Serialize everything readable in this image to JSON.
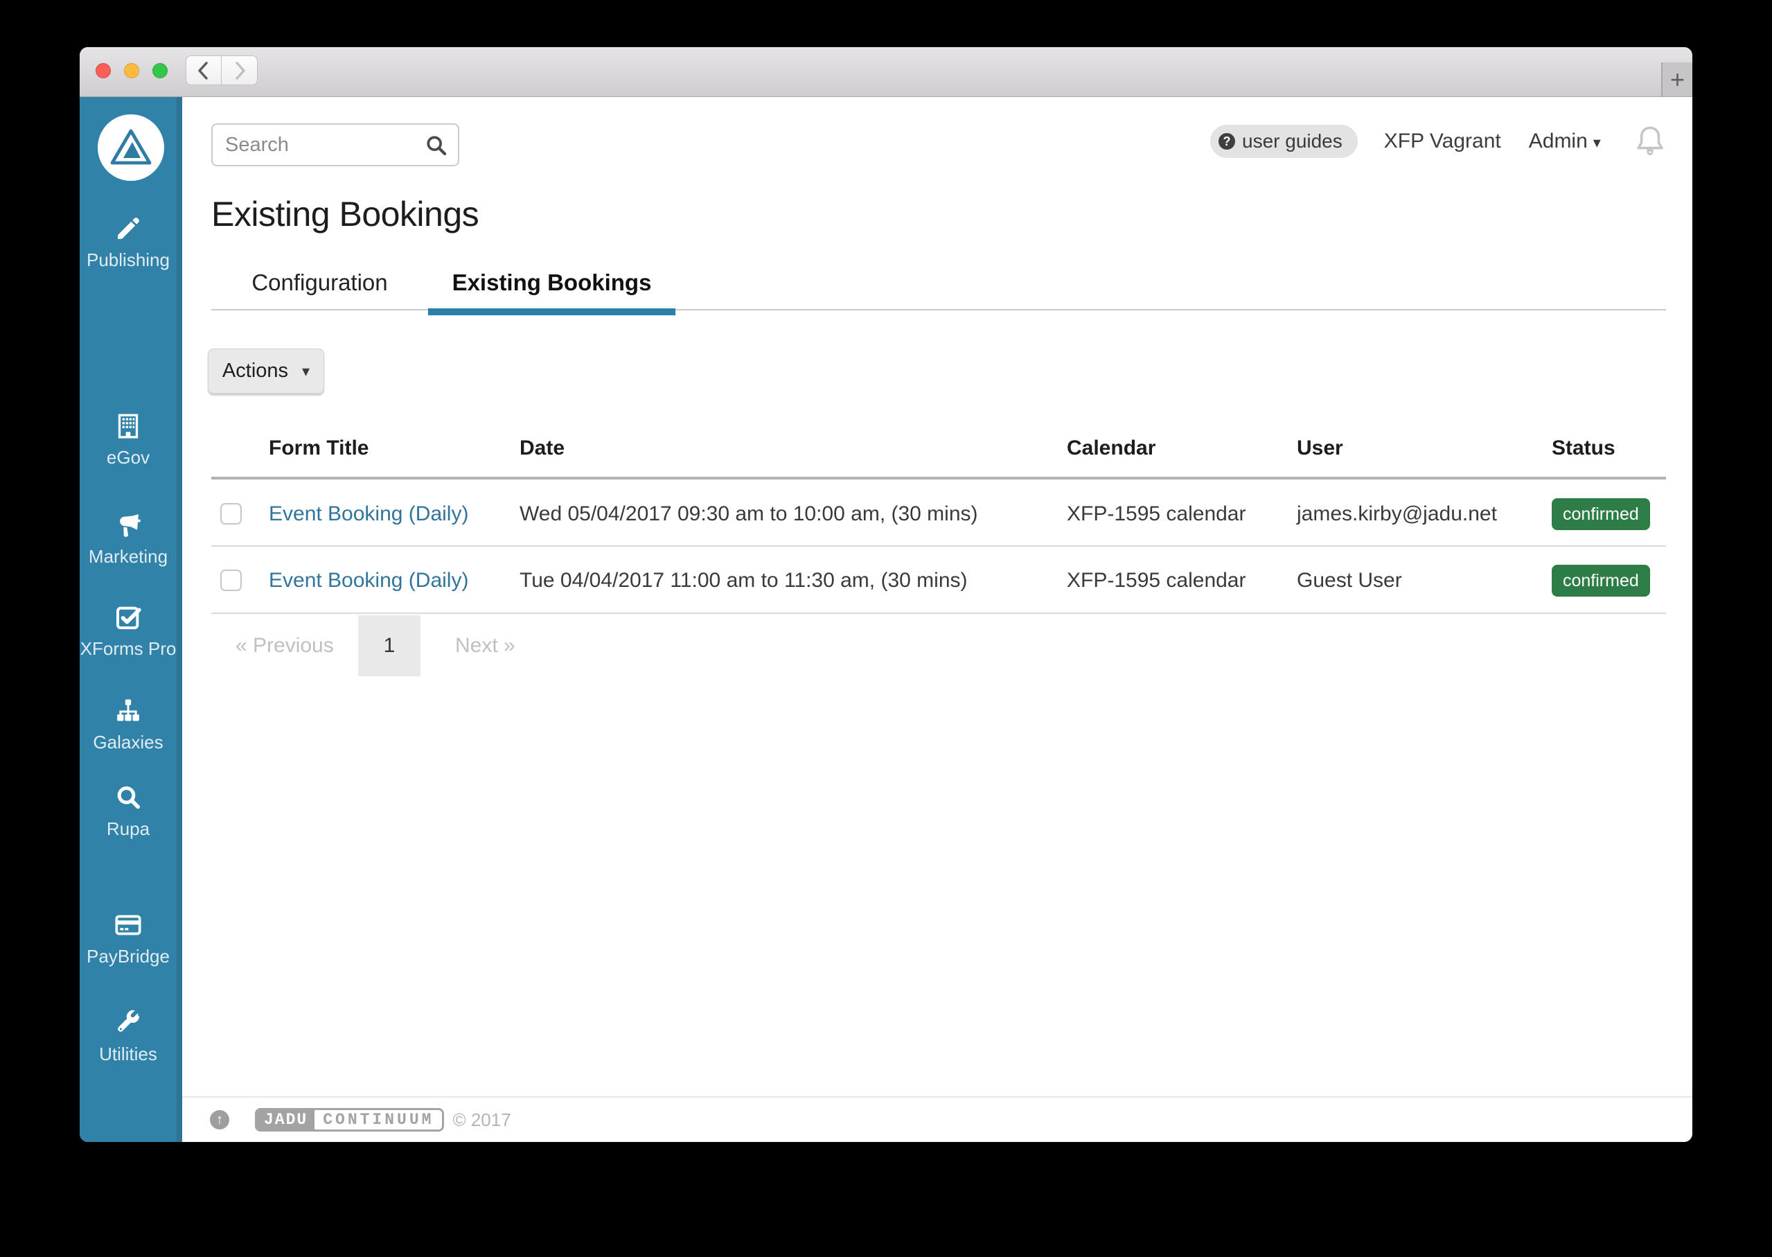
{
  "window": {
    "new_tab_label": "+"
  },
  "sidebar": {
    "items": [
      {
        "label": "Publishing",
        "icon": "pencil-icon"
      },
      {
        "label": "eGov",
        "icon": "building-icon"
      },
      {
        "label": "Marketing",
        "icon": "megaphone-icon"
      },
      {
        "label": "XForms Pro",
        "icon": "checkbox-icon"
      },
      {
        "label": "Galaxies",
        "icon": "sitemap-icon"
      },
      {
        "label": "Rupa",
        "icon": "magnifier-icon"
      },
      {
        "label": "PayBridge",
        "icon": "credit-card-icon"
      },
      {
        "label": "Utilities",
        "icon": "wrench-icon"
      }
    ]
  },
  "header": {
    "search_placeholder": "Search",
    "user_guides_label": "user guides",
    "account_label": "XFP Vagrant",
    "admin_label": "Admin"
  },
  "page": {
    "title": "Existing Bookings"
  },
  "tabs": [
    {
      "label": "Configuration",
      "active": false
    },
    {
      "label": "Existing Bookings",
      "active": true
    }
  ],
  "actions": {
    "label": "Actions"
  },
  "table": {
    "columns": [
      "Form Title",
      "Date",
      "Calendar",
      "User",
      "Status"
    ],
    "rows": [
      {
        "form_title": "Event Booking (Daily)",
        "date": "Wed 05/04/2017 09:30 am to 10:00 am, (30 mins)",
        "calendar": "XFP-1595 calendar",
        "user": "james.kirby@jadu.net",
        "status": "confirmed"
      },
      {
        "form_title": "Event Booking (Daily)",
        "date": "Tue 04/04/2017 11:00 am to 11:30 am, (30 mins)",
        "calendar": "XFP-1595 calendar",
        "user": "Guest User",
        "status": "confirmed"
      }
    ]
  },
  "pagination": {
    "previous": "« Previous",
    "page": "1",
    "next": "Next »"
  },
  "footer": {
    "brand_left": "JADU",
    "brand_right": "CONTINUUM",
    "copyright": "© 2017"
  },
  "colors": {
    "sidebar_blue": "#3182a9",
    "accent_blue": "#2a80aa",
    "link_blue": "#31759b",
    "badge_green": "#2e7d46"
  }
}
